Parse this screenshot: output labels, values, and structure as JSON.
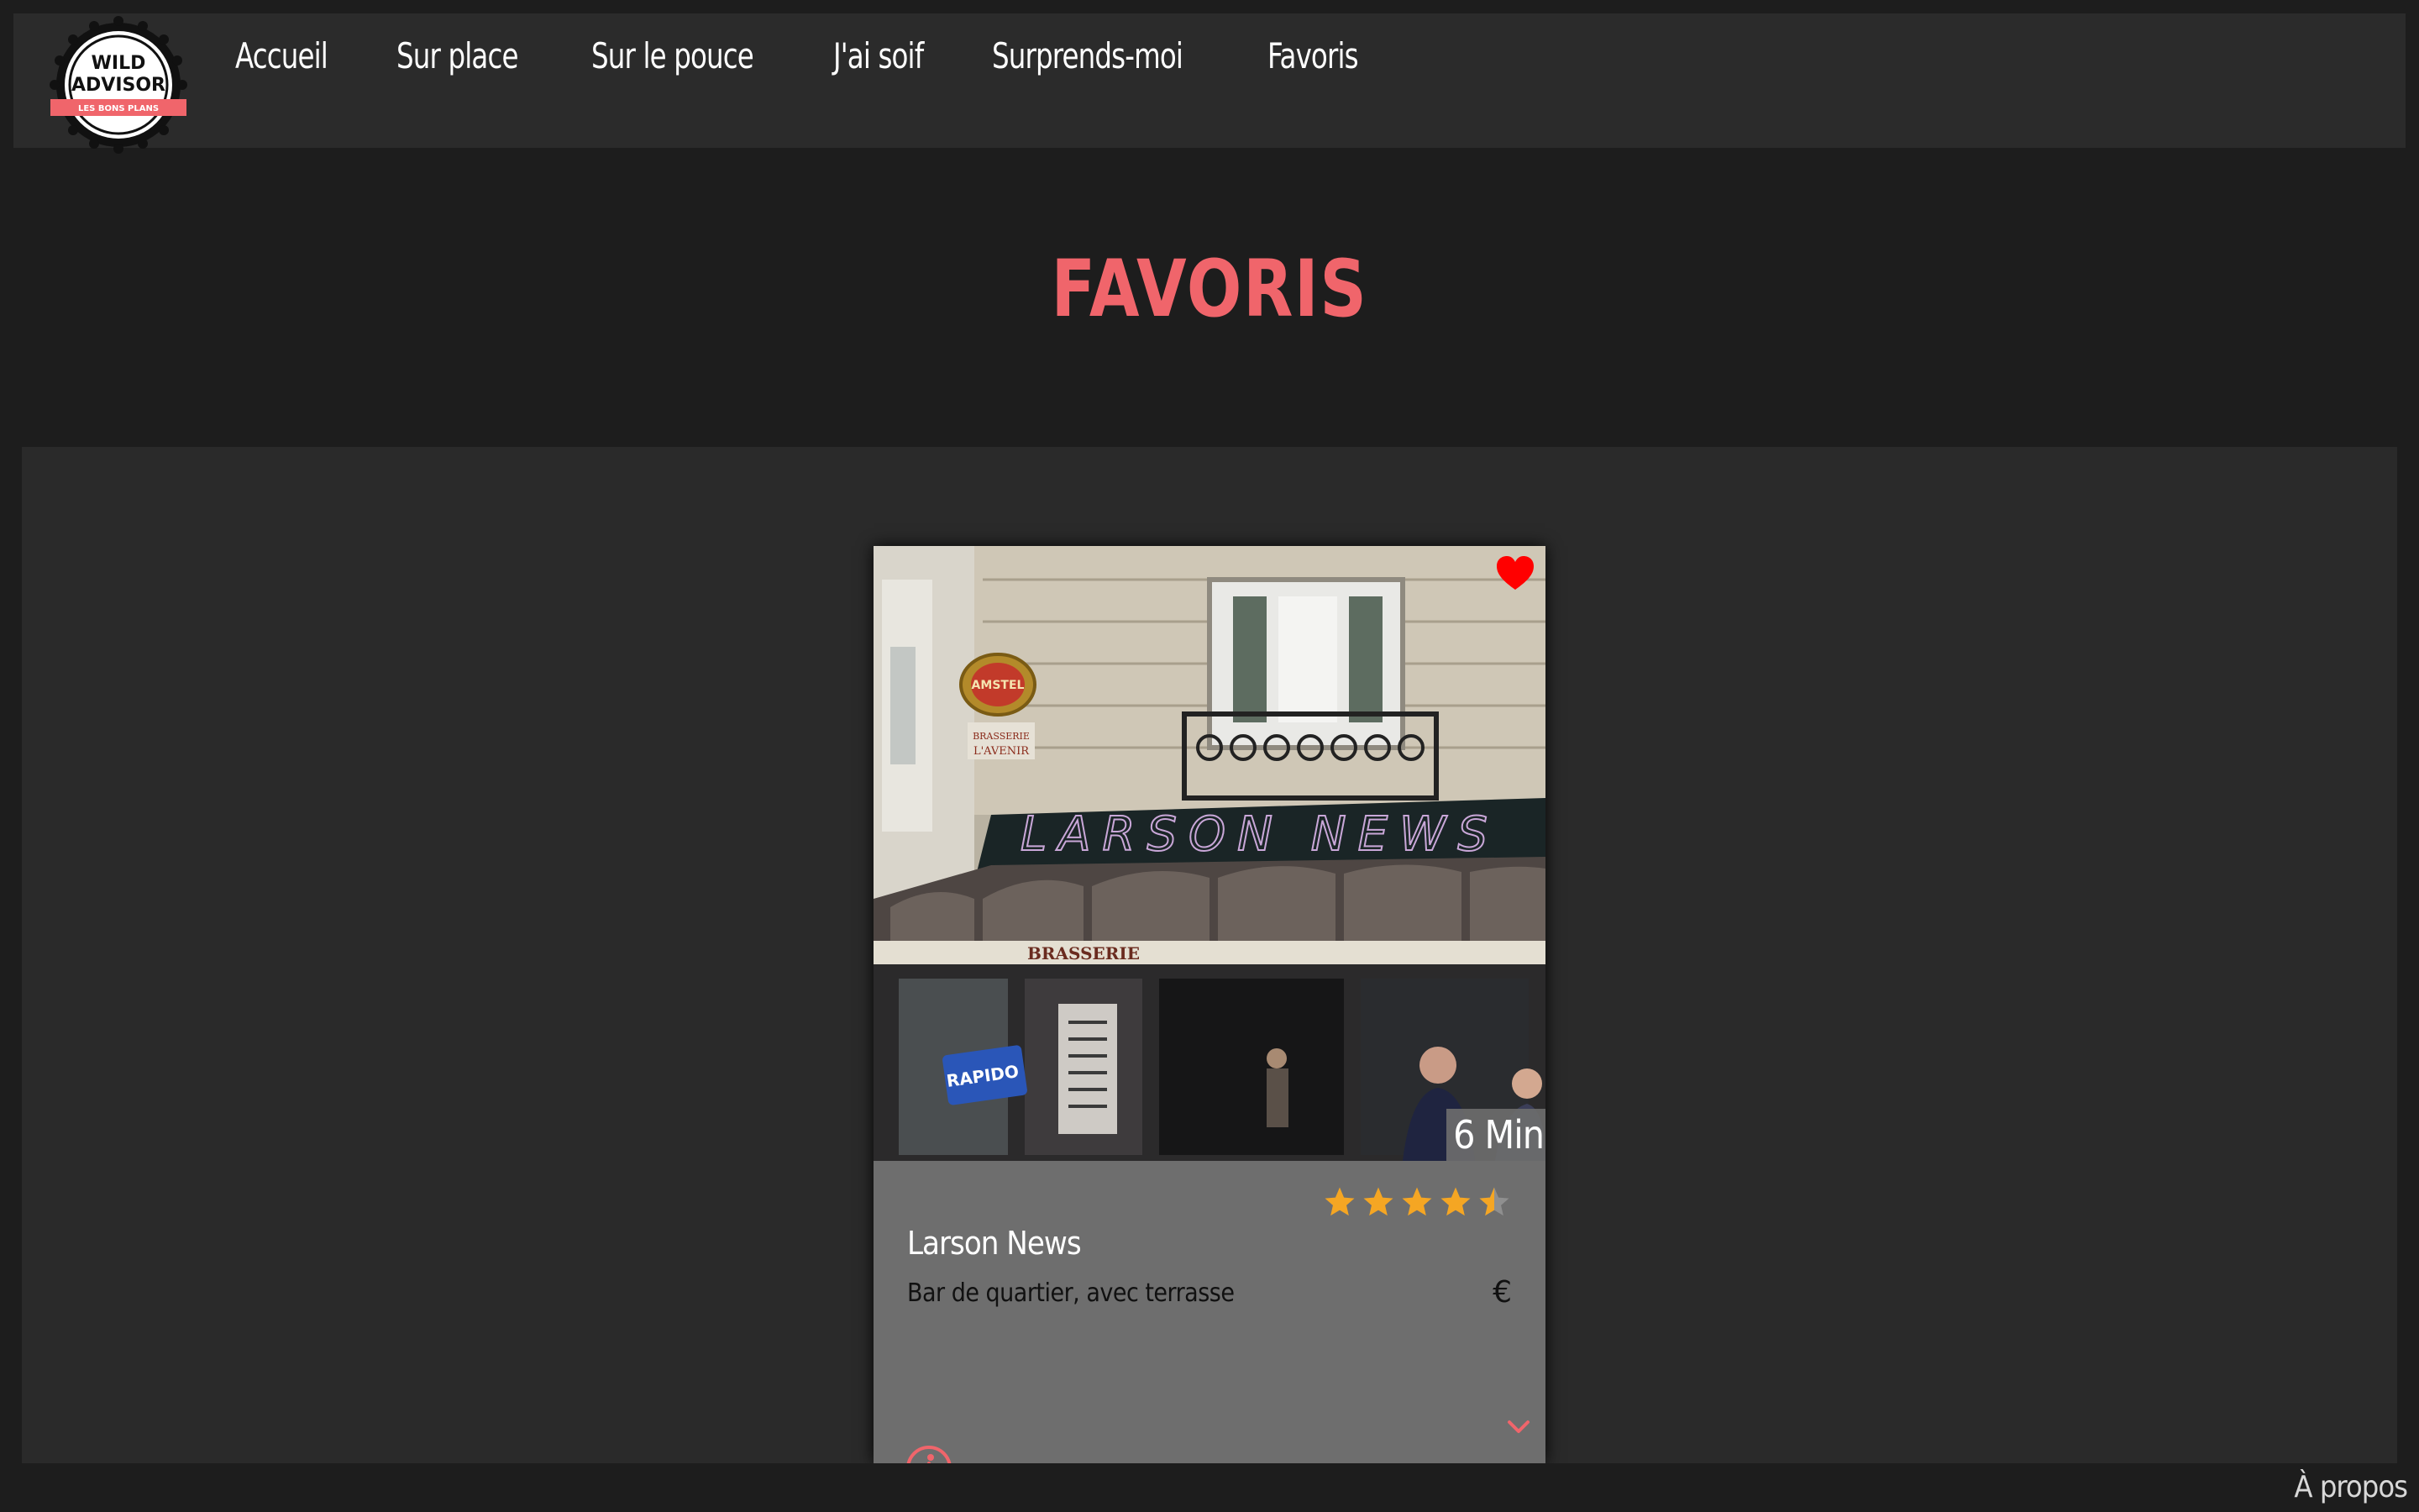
{
  "logo": {
    "line1": "WILD",
    "line2": "ADVISOR",
    "ribbon": "LES BONS PLANS"
  },
  "nav": {
    "items": [
      {
        "label": "Accueil"
      },
      {
        "label": "Sur place"
      },
      {
        "label": "Sur le pouce"
      },
      {
        "label": "J'ai soif"
      },
      {
        "label": "Surprends-moi"
      },
      {
        "label": "Favoris"
      }
    ]
  },
  "page": {
    "title": "FAVORIS"
  },
  "card": {
    "photo_signs": {
      "storefront": "LARSON NEWS",
      "awning": "BRASSERIE",
      "beer_sign": "AMSTEL",
      "brasserie_sign": "BRASSERIE L'AVENIR",
      "window_sign": "RAPIDO"
    },
    "favorite_icon": "heart-icon",
    "time": "6 Min",
    "rating": 4.5,
    "rating_max": 5,
    "name": "Larson News",
    "description": "Bar de quartier, avec terrasse",
    "price": "€",
    "expand_icon": "chevron-down-icon",
    "info_icon": "wheelchair-icon"
  },
  "footer": {
    "about": "À propos"
  },
  "colors": {
    "accent": "#f0656b",
    "heart": "#ff0000",
    "star": "#f5a623",
    "background": "#1d1d1d",
    "panel": "#2a2a2a",
    "navbar": "#2b2b2b",
    "card": "#6e6e6e"
  }
}
